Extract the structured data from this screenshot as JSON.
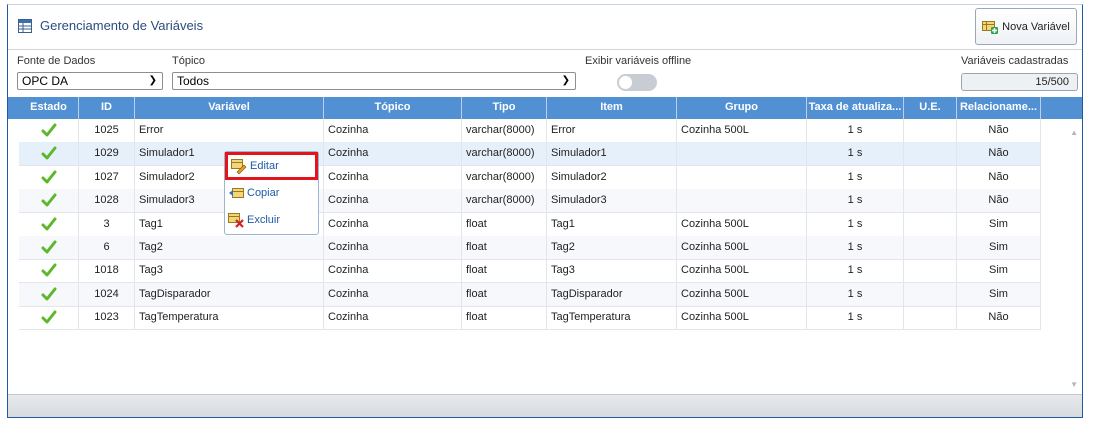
{
  "header": {
    "title": "Gerenciamento de Variáveis",
    "new_button": "Nova Variável"
  },
  "filters": {
    "source_label": "Fonte de Dados",
    "source_value": "OPC DA",
    "topic_label": "Tópico",
    "topic_value": "Todos",
    "offline_label": "Exibir variáveis offline",
    "registered_label": "Variáveis cadastradas",
    "registered_value": "15/500"
  },
  "columns": [
    "Estado",
    "ID",
    "Variável",
    "Tópico",
    "Tipo",
    "Item",
    "Grupo",
    "Taxa de atualiza...",
    "U.E.",
    "Relacioname..."
  ],
  "rows": [
    {
      "id": "1025",
      "var": "Error",
      "topic": "Cozinha",
      "type": "varchar(8000)",
      "item": "Error",
      "group": "Cozinha 500L",
      "rate": "1 s",
      "ue": "",
      "rel": "Não"
    },
    {
      "id": "1029",
      "var": "Simulador1",
      "topic": "Cozinha",
      "type": "varchar(8000)",
      "item": "Simulador1",
      "group": "",
      "rate": "1 s",
      "ue": "",
      "rel": "Não"
    },
    {
      "id": "1027",
      "var": "Simulador2",
      "topic": "Cozinha",
      "type": "varchar(8000)",
      "item": "Simulador2",
      "group": "",
      "rate": "1 s",
      "ue": "",
      "rel": "Não"
    },
    {
      "id": "1028",
      "var": "Simulador3",
      "topic": "Cozinha",
      "type": "varchar(8000)",
      "item": "Simulador3",
      "group": "",
      "rate": "1 s",
      "ue": "",
      "rel": "Não"
    },
    {
      "id": "3",
      "var": "Tag1",
      "topic": "Cozinha",
      "type": "float",
      "item": "Tag1",
      "group": "Cozinha 500L",
      "rate": "1 s",
      "ue": "",
      "rel": "Sim"
    },
    {
      "id": "6",
      "var": "Tag2",
      "topic": "Cozinha",
      "type": "float",
      "item": "Tag2",
      "group": "Cozinha 500L",
      "rate": "1 s",
      "ue": "",
      "rel": "Sim"
    },
    {
      "id": "1018",
      "var": "Tag3",
      "topic": "Cozinha",
      "type": "float",
      "item": "Tag3",
      "group": "Cozinha 500L",
      "rate": "1 s",
      "ue": "",
      "rel": "Sim"
    },
    {
      "id": "1024",
      "var": "TagDisparador",
      "topic": "Cozinha",
      "type": "float",
      "item": "TagDisparador",
      "group": "Cozinha 500L",
      "rate": "1 s",
      "ue": "",
      "rel": "Sim"
    },
    {
      "id": "1023",
      "var": "TagTemperatura",
      "topic": "Cozinha",
      "type": "float",
      "item": "TagTemperatura",
      "group": "Cozinha 500L",
      "rate": "1 s",
      "ue": "",
      "rel": "Não"
    }
  ],
  "context_menu": {
    "edit": "Editar",
    "copy": "Copiar",
    "delete": "Excluir"
  },
  "icons": {
    "title": "variables-table-icon",
    "new": "add-variable-icon",
    "status": "check-icon",
    "edit": "edit-icon",
    "copy": "copy-icon",
    "delete": "delete-icon"
  },
  "colors": {
    "header_bg": "#5290d4",
    "title": "#2b4c7e",
    "check": "#5cb82a",
    "highlight": "#e4141b"
  }
}
